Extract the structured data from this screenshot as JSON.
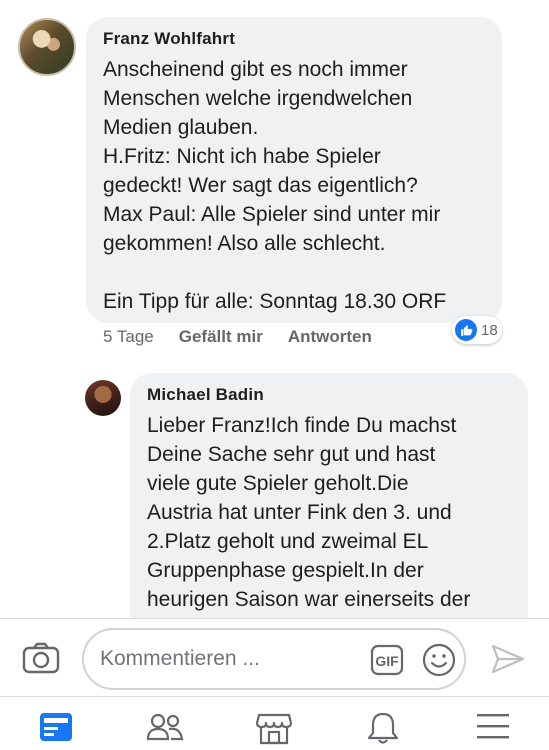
{
  "comment": {
    "author": "Franz Wohlfahrt",
    "lines": [
      "Anscheinend gibt es noch immer",
      "Menschen welche irgendwelchen",
      "Medien glauben.",
      "H.Fritz: Nicht ich habe Spieler",
      "gedeckt! Wer sagt das eigentlich?",
      "Max Paul: Alle Spieler sind unter mir",
      "gekommen! Also alle schlecht.",
      "",
      "Ein Tipp für alle: Sonntag 18.30 ORF"
    ],
    "time": "5 Tage",
    "like_label": "Gefällt mir",
    "reply_label": "Antworten",
    "reaction_count": "18"
  },
  "reply": {
    "author": "Michael Badin",
    "lines": [
      "Lieber Franz!Ich finde Du machst",
      "Deine Sache sehr gut und hast",
      "viele gute Spieler geholt.Die",
      "Austria hat unter Fink den 3. und",
      "2.Platz geholt und zweimal EL",
      "Gruppenphase gespielt.In der",
      "heurigen Saison war einerseits der"
    ]
  },
  "composer": {
    "placeholder": "Kommentieren ...",
    "gif_label": "GIF"
  },
  "colors": {
    "bubble": "#f0f1f3",
    "like_blue": "#1877f2",
    "active_tab": "#1877f2",
    "icon_gray": "#65676b"
  },
  "tabs": [
    "feed-icon",
    "friends-icon",
    "marketplace-icon",
    "notifications-icon",
    "menu-icon"
  ]
}
